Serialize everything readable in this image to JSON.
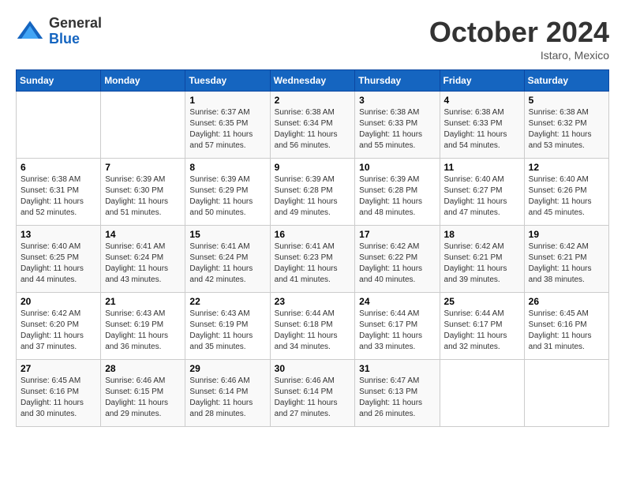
{
  "logo": {
    "general": "General",
    "blue": "Blue"
  },
  "title": "October 2024",
  "location": "Istaro, Mexico",
  "days_of_week": [
    "Sunday",
    "Monday",
    "Tuesday",
    "Wednesday",
    "Thursday",
    "Friday",
    "Saturday"
  ],
  "weeks": [
    [
      {
        "day": null,
        "info": null
      },
      {
        "day": null,
        "info": null
      },
      {
        "day": "1",
        "info": "Sunrise: 6:37 AM\nSunset: 6:35 PM\nDaylight: 11 hours and 57 minutes."
      },
      {
        "day": "2",
        "info": "Sunrise: 6:38 AM\nSunset: 6:34 PM\nDaylight: 11 hours and 56 minutes."
      },
      {
        "day": "3",
        "info": "Sunrise: 6:38 AM\nSunset: 6:33 PM\nDaylight: 11 hours and 55 minutes."
      },
      {
        "day": "4",
        "info": "Sunrise: 6:38 AM\nSunset: 6:33 PM\nDaylight: 11 hours and 54 minutes."
      },
      {
        "day": "5",
        "info": "Sunrise: 6:38 AM\nSunset: 6:32 PM\nDaylight: 11 hours and 53 minutes."
      }
    ],
    [
      {
        "day": "6",
        "info": "Sunrise: 6:38 AM\nSunset: 6:31 PM\nDaylight: 11 hours and 52 minutes."
      },
      {
        "day": "7",
        "info": "Sunrise: 6:39 AM\nSunset: 6:30 PM\nDaylight: 11 hours and 51 minutes."
      },
      {
        "day": "8",
        "info": "Sunrise: 6:39 AM\nSunset: 6:29 PM\nDaylight: 11 hours and 50 minutes."
      },
      {
        "day": "9",
        "info": "Sunrise: 6:39 AM\nSunset: 6:28 PM\nDaylight: 11 hours and 49 minutes."
      },
      {
        "day": "10",
        "info": "Sunrise: 6:39 AM\nSunset: 6:28 PM\nDaylight: 11 hours and 48 minutes."
      },
      {
        "day": "11",
        "info": "Sunrise: 6:40 AM\nSunset: 6:27 PM\nDaylight: 11 hours and 47 minutes."
      },
      {
        "day": "12",
        "info": "Sunrise: 6:40 AM\nSunset: 6:26 PM\nDaylight: 11 hours and 45 minutes."
      }
    ],
    [
      {
        "day": "13",
        "info": "Sunrise: 6:40 AM\nSunset: 6:25 PM\nDaylight: 11 hours and 44 minutes."
      },
      {
        "day": "14",
        "info": "Sunrise: 6:41 AM\nSunset: 6:24 PM\nDaylight: 11 hours and 43 minutes."
      },
      {
        "day": "15",
        "info": "Sunrise: 6:41 AM\nSunset: 6:24 PM\nDaylight: 11 hours and 42 minutes."
      },
      {
        "day": "16",
        "info": "Sunrise: 6:41 AM\nSunset: 6:23 PM\nDaylight: 11 hours and 41 minutes."
      },
      {
        "day": "17",
        "info": "Sunrise: 6:42 AM\nSunset: 6:22 PM\nDaylight: 11 hours and 40 minutes."
      },
      {
        "day": "18",
        "info": "Sunrise: 6:42 AM\nSunset: 6:21 PM\nDaylight: 11 hours and 39 minutes."
      },
      {
        "day": "19",
        "info": "Sunrise: 6:42 AM\nSunset: 6:21 PM\nDaylight: 11 hours and 38 minutes."
      }
    ],
    [
      {
        "day": "20",
        "info": "Sunrise: 6:42 AM\nSunset: 6:20 PM\nDaylight: 11 hours and 37 minutes."
      },
      {
        "day": "21",
        "info": "Sunrise: 6:43 AM\nSunset: 6:19 PM\nDaylight: 11 hours and 36 minutes."
      },
      {
        "day": "22",
        "info": "Sunrise: 6:43 AM\nSunset: 6:19 PM\nDaylight: 11 hours and 35 minutes."
      },
      {
        "day": "23",
        "info": "Sunrise: 6:44 AM\nSunset: 6:18 PM\nDaylight: 11 hours and 34 minutes."
      },
      {
        "day": "24",
        "info": "Sunrise: 6:44 AM\nSunset: 6:17 PM\nDaylight: 11 hours and 33 minutes."
      },
      {
        "day": "25",
        "info": "Sunrise: 6:44 AM\nSunset: 6:17 PM\nDaylight: 11 hours and 32 minutes."
      },
      {
        "day": "26",
        "info": "Sunrise: 6:45 AM\nSunset: 6:16 PM\nDaylight: 11 hours and 31 minutes."
      }
    ],
    [
      {
        "day": "27",
        "info": "Sunrise: 6:45 AM\nSunset: 6:16 PM\nDaylight: 11 hours and 30 minutes."
      },
      {
        "day": "28",
        "info": "Sunrise: 6:46 AM\nSunset: 6:15 PM\nDaylight: 11 hours and 29 minutes."
      },
      {
        "day": "29",
        "info": "Sunrise: 6:46 AM\nSunset: 6:14 PM\nDaylight: 11 hours and 28 minutes."
      },
      {
        "day": "30",
        "info": "Sunrise: 6:46 AM\nSunset: 6:14 PM\nDaylight: 11 hours and 27 minutes."
      },
      {
        "day": "31",
        "info": "Sunrise: 6:47 AM\nSunset: 6:13 PM\nDaylight: 11 hours and 26 minutes."
      },
      {
        "day": null,
        "info": null
      },
      {
        "day": null,
        "info": null
      }
    ]
  ]
}
